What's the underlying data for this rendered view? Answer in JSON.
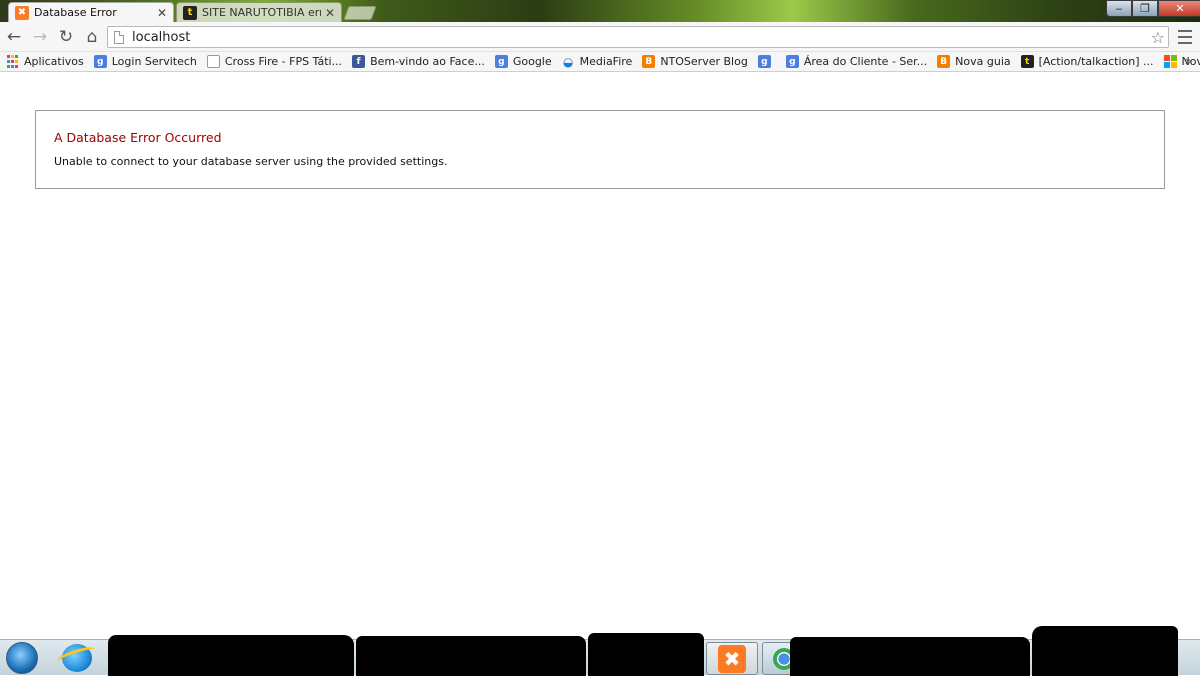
{
  "browser": {
    "tabs": [
      {
        "title": "Database Error",
        "favicon": "xampp-icon",
        "active": true
      },
      {
        "title": "SITE NARUTOTIBIA erro -",
        "favicon": "tibia-icon",
        "active": false
      }
    ],
    "address_bar": {
      "url": "localhost"
    },
    "bookmarks": [
      {
        "label": "Aplicativos",
        "icon": "apps-grid-icon"
      },
      {
        "label": "Login Servitech",
        "icon": "google-icon"
      },
      {
        "label": "Cross Fire - FPS Táti...",
        "icon": "page-icon"
      },
      {
        "label": "Bem-vindo ao Face...",
        "icon": "facebook-icon"
      },
      {
        "label": "Google",
        "icon": "google-icon"
      },
      {
        "label": "MediaFire",
        "icon": "mediafire-icon"
      },
      {
        "label": "NTOServer Blog",
        "icon": "blogger-icon"
      },
      {
        "label": "",
        "icon": "google-icon"
      },
      {
        "label": "Área do Cliente - Ser...",
        "icon": "google-icon"
      },
      {
        "label": "Nova guia",
        "icon": "blogger-icon"
      },
      {
        "label": "[Action/talkaction] ...",
        "icon": "tibia-icon"
      },
      {
        "label": "Nova guia",
        "icon": "microsoft-icon"
      }
    ]
  },
  "page": {
    "error_title": "A Database Error Occurred",
    "error_message": "Unable to connect to your database server using the provided settings."
  },
  "colors": {
    "error_title": "#990000",
    "xampp_orange": "#fb7a24",
    "box_border": "#9a9a9a"
  }
}
